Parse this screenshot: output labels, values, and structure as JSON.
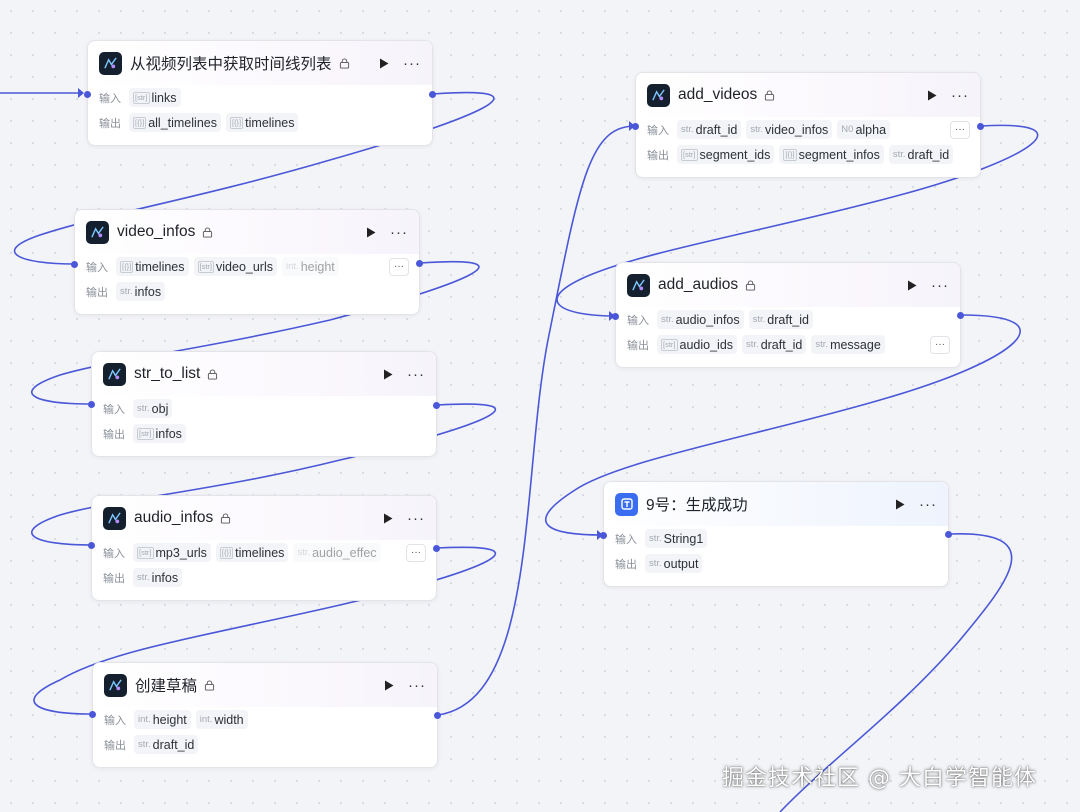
{
  "labels": {
    "input": "输入",
    "output": "输出",
    "more": "···"
  },
  "nodes": [
    {
      "id": "timeline",
      "title": "从视频列表中获取时间线列表",
      "inputs": [
        {
          "type": "[str]",
          "name": "links"
        }
      ],
      "outputs": [
        {
          "type": "[{}]",
          "name": "all_timelines"
        },
        {
          "type": "[{}]",
          "name": "timelines"
        }
      ]
    },
    {
      "id": "video_infos",
      "title": "video_infos",
      "inputs": [
        {
          "type": "[{}]",
          "name": "timelines"
        },
        {
          "type": "[str]",
          "name": "video_urls"
        },
        {
          "type": "int.",
          "name": "height"
        }
      ],
      "outputs": [
        {
          "type": "str.",
          "name": "infos"
        }
      ]
    },
    {
      "id": "str_to_list",
      "title": "str_to_list",
      "inputs": [
        {
          "type": "str.",
          "name": "obj"
        }
      ],
      "outputs": [
        {
          "type": "[str]",
          "name": "infos"
        }
      ]
    },
    {
      "id": "audio_infos",
      "title": "audio_infos",
      "inputs": [
        {
          "type": "[str]",
          "name": "mp3_urls"
        },
        {
          "type": "[{}]",
          "name": "timelines"
        },
        {
          "type": "str.",
          "name": "audio_effec"
        }
      ],
      "outputs": [
        {
          "type": "str.",
          "name": "infos"
        }
      ]
    },
    {
      "id": "create_draft",
      "title": "创建草稿",
      "inputs": [
        {
          "type": "int.",
          "name": "height"
        },
        {
          "type": "int.",
          "name": "width"
        }
      ],
      "outputs": [
        {
          "type": "str.",
          "name": "draft_id"
        }
      ]
    },
    {
      "id": "add_videos",
      "title": "add_videos",
      "inputs": [
        {
          "type": "str.",
          "name": "draft_id"
        },
        {
          "type": "str.",
          "name": "video_infos"
        },
        {
          "type": "N0",
          "name": "alpha"
        }
      ],
      "outputs": [
        {
          "type": "[str]",
          "name": "segment_ids"
        },
        {
          "type": "[{}]",
          "name": "segment_infos"
        },
        {
          "type": "str.",
          "name": "draft_id"
        }
      ]
    },
    {
      "id": "add_audios",
      "title": "add_audios",
      "inputs": [
        {
          "type": "str.",
          "name": "audio_infos"
        },
        {
          "type": "str.",
          "name": "draft_id"
        }
      ],
      "outputs": [
        {
          "type": "[str]",
          "name": "audio_ids"
        },
        {
          "type": "str.",
          "name": "draft_id"
        },
        {
          "type": "str.",
          "name": "message"
        }
      ]
    },
    {
      "id": "node9",
      "title": "9号：生成成功",
      "inputs": [
        {
          "type": "str.",
          "name": "String1"
        }
      ],
      "outputs": [
        {
          "type": "str.",
          "name": "output"
        }
      ]
    }
  ],
  "watermark": "掘金技术社区 @ 大白学智能体",
  "colors": {
    "edge": "#4a57d8",
    "canvas": "#f3f4f7",
    "plugin_icon": "#15202e",
    "text_node_icon": "#3b6df0"
  }
}
